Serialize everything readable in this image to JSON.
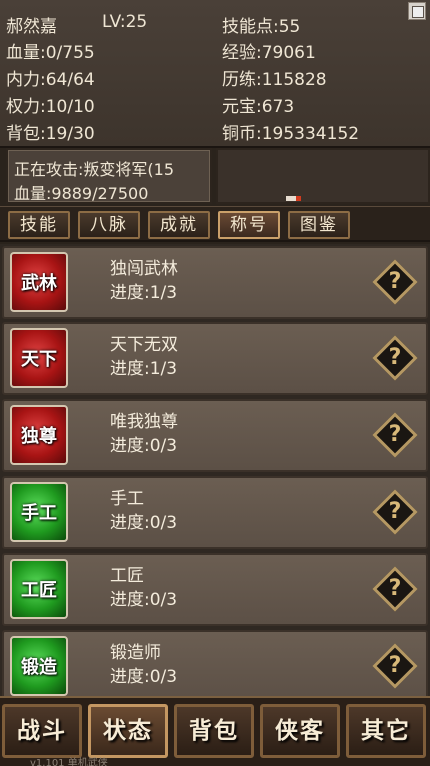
{
  "character": {
    "name": "郝然嘉",
    "level": "LV:25",
    "skill_points": "技能点:55",
    "hp": "血量:0/755",
    "exp": "经验:79061",
    "mp": "内力:64/64",
    "training": "历练:115828",
    "power": "权力:10/10",
    "yuanbao": "元宝:673",
    "bag": "背包:19/30",
    "copper": "铜币:195334152"
  },
  "target": {
    "attacking": "正在攻击:叛变将军(15",
    "hp": "血量:9889/27500"
  },
  "tabs": [
    "技能",
    "八脉",
    "成就",
    "称号",
    "图鉴"
  ],
  "active_tab": "称号",
  "titles": [
    {
      "badge": "武林",
      "color": "red",
      "name": "独闯武林",
      "progress": "进度:1/3"
    },
    {
      "badge": "天下",
      "color": "red",
      "name": "天下无双",
      "progress": "进度:1/3"
    },
    {
      "badge": "独尊",
      "color": "red",
      "name": "唯我独尊",
      "progress": "进度:0/3"
    },
    {
      "badge": "手工",
      "color": "green",
      "name": "手工",
      "progress": "进度:0/3"
    },
    {
      "badge": "工匠",
      "color": "green",
      "name": "工匠",
      "progress": "进度:0/3"
    },
    {
      "badge": "锻造",
      "color": "green",
      "name": "锻造师",
      "progress": "进度:0/3"
    }
  ],
  "help_icon": "?",
  "bottom_nav": [
    "战斗",
    "状态",
    "背包",
    "侠客",
    "其它"
  ],
  "active_nav": "状态",
  "footer": "v1.101 单机武侠"
}
